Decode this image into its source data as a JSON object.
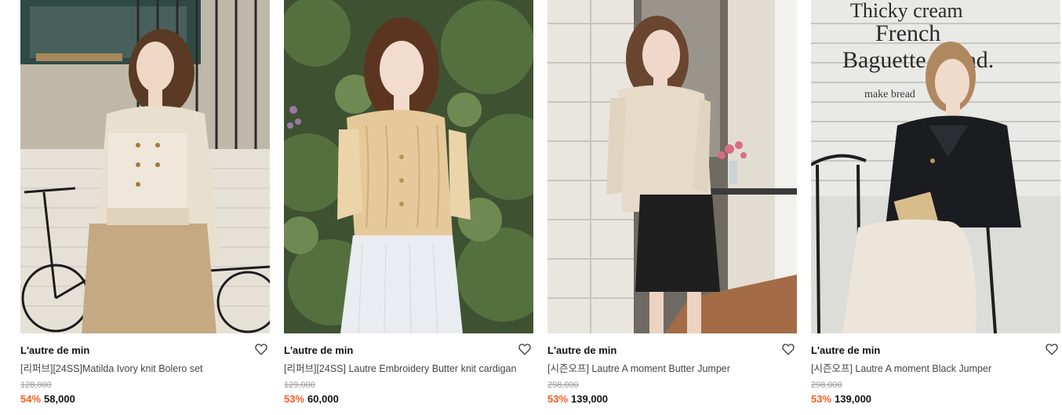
{
  "products": [
    {
      "brand": "L'autre de min",
      "name": "[리퍼브][24SS]Matilda Ivory knit Bolero set",
      "original_price": "128,000",
      "discount": "54%",
      "price": "58,000"
    },
    {
      "brand": "L'autre de min",
      "name": "[리퍼브][24SS] Lautre Embroidery Butter knit cardigan",
      "original_price": "129,000",
      "discount": "53%",
      "price": "60,000"
    },
    {
      "brand": "L'autre de min",
      "name": "[시즌오프] Lautre A moment Butter Jumper",
      "original_price": "298,000",
      "discount": "53%",
      "price": "139,000"
    },
    {
      "brand": "L'autre de min",
      "name": "[시즌오프] Lautre A moment Black Jumper",
      "original_price": "298,000",
      "discount": "53%",
      "price": "139,000"
    }
  ],
  "photo_signs": {
    "bakery_line1": "Thicky cream",
    "bakery_line2": "French",
    "bakery_line3": "Baguette Bread.",
    "bakery_line4": "make bread"
  },
  "colors": {
    "discount": "#ff5a1f",
    "brand_text": "#111111",
    "name_text": "#444444",
    "strike_text": "#9a9a9a"
  },
  "icons": [
    "heart-outline-icon"
  ]
}
